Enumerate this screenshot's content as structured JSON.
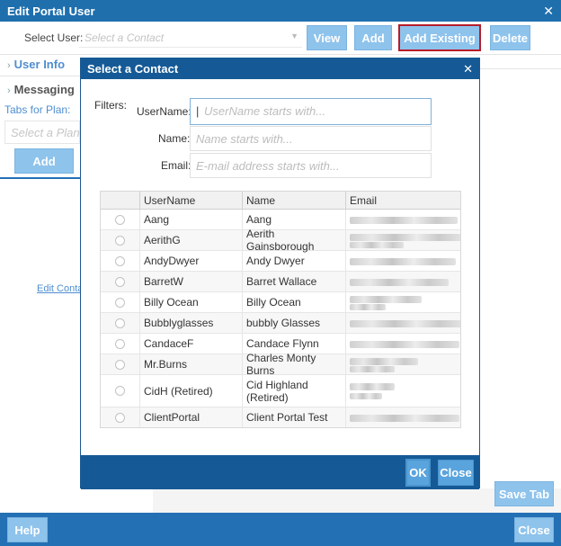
{
  "window": {
    "title": "Edit Portal User",
    "close_glyph": "✕"
  },
  "toolbar": {
    "select_user_label": "Select User:",
    "select_user_placeholder": "Select a Contact",
    "view": "View",
    "add": "Add",
    "add_existing": "Add Existing",
    "delete": "Delete"
  },
  "left_panel": {
    "user_info": "User Info",
    "messaging": "Messaging",
    "tabs_for_plan": "Tabs for Plan:",
    "select_plan_placeholder": "Select a Plan",
    "add": "Add",
    "edit_contact": "Edit Contact"
  },
  "footer": {
    "help": "Help",
    "close": "Close",
    "save_tab": "Save Tab"
  },
  "modal": {
    "title": "Select a Contact",
    "close_glyph": "✕",
    "filters_label": "Filters:",
    "username_label": "UserName:",
    "username_placeholder": "UserName starts with...",
    "name_label": "Name:",
    "name_placeholder": "Name starts with...",
    "email_label": "Email:",
    "email_placeholder": "E-mail address starts with...",
    "columns": [
      "UserName",
      "Name",
      "Email"
    ],
    "rows": [
      {
        "username": "Aang",
        "name": "Aang"
      },
      {
        "username": "AerithG",
        "name": "Aerith Gainsborough"
      },
      {
        "username": "AndyDwyer",
        "name": "Andy Dwyer"
      },
      {
        "username": "BarretW",
        "name": "Barret Wallace"
      },
      {
        "username": "Billy Ocean",
        "name": "Billy Ocean"
      },
      {
        "username": "Bubblyglasses",
        "name": "bubbly Glasses"
      },
      {
        "username": "CandaceF",
        "name": "Candace Flynn"
      },
      {
        "username": "Mr.Burns",
        "name": "Charles Monty Burns"
      },
      {
        "username": "CidH (Retired)",
        "name": "Cid Highland (Retired)"
      },
      {
        "username": "ClientPortal",
        "name": "Client Portal Test"
      }
    ],
    "ok": "OK",
    "close": "Close"
  },
  "colors": {
    "header": "#1f6fad",
    "modal_header": "#155a96",
    "button": "#8ec3ec",
    "highlight": "#b71c2b"
  }
}
